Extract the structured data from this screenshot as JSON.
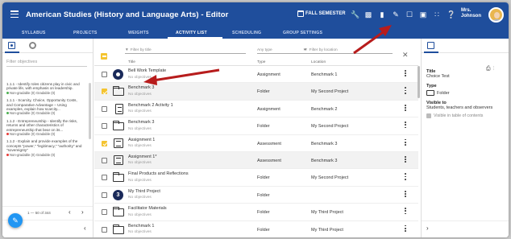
{
  "app": {
    "title": "American Studies (History and Language Arts) - Editor",
    "term": "FALL SEMESTER",
    "user": [
      "Mrs.",
      "Johnson"
    ]
  },
  "toolbar_icons": [
    "wrench-icon",
    "document-icon",
    "trash-icon",
    "pencil-icon",
    "clipboard-icon",
    "chat-icon",
    "apps-grid-icon",
    "help-icon"
  ],
  "nav": {
    "tabs": [
      "SYLLABUS",
      "PROJECTS",
      "WEIGHTS",
      "ACTIVITY LIST",
      "SCHEDULING",
      "GROUP SETTINGS"
    ],
    "active": "ACTIVITY LIST"
  },
  "left_panel": {
    "filter_placeholder": "Filter objectives",
    "objectives": [
      {
        "text": "1.1.1 - Identify roles citizens play in civic and private life, with emphasis on leadership.",
        "meta": "Non-gradable (0)  Gradable (0)",
        "dot": "#4caf50"
      },
      {
        "text": "1.1.1 - Scarcity, Choice, Opportunity Costs, and Comparative Advantage – Using examples, explain how scarcity...",
        "meta": "Non-gradable (0)  Gradable (0)",
        "dot": "#4caf50"
      },
      {
        "text": "1.1.2 - Entrepreneurship - Identify the risks, returns and other characteristics of entrepreneurship that bear on its...",
        "meta": "Non-gradable (0)  Gradable (0)",
        "dot": "#e53935"
      },
      {
        "text": "1.1.2 - Explain and provide examples of the concepts \"power,\" \"legitimacy,\" \"authority\" and \"sovereignty\"",
        "meta": "Non-gradable (0)  Gradable (0)",
        "dot": "#e53935"
      }
    ],
    "pagination": "1 — 50 of 344"
  },
  "main": {
    "filter_title_placeholder": "Filter by title",
    "filter_type": "Any type",
    "filter_location_placeholder": "Filter by location",
    "col_title": "Title",
    "col_type": "Type",
    "col_location": "Location",
    "rows": [
      {
        "icon": "disc",
        "name": "Bell Work Template",
        "objectives": "No objectives",
        "type": "Assignment",
        "location": "Benchmark 1",
        "checked": false,
        "selected": false
      },
      {
        "icon": "folder",
        "name": "Benchmark 3",
        "objectives": "No objectives",
        "type": "Folder",
        "location": "My Second Project",
        "checked": true,
        "selected": true
      },
      {
        "icon": "page",
        "name": "Benchmark 2 Activity 1",
        "objectives": "No objectives",
        "type": "Assignment",
        "location": "Benchmark 2",
        "checked": false,
        "selected": false
      },
      {
        "icon": "folder",
        "name": "Benchmark 3",
        "objectives": "No objectives",
        "type": "Folder",
        "location": "My Second Project",
        "checked": false,
        "selected": false
      },
      {
        "icon": "assess",
        "name": "Assignment 1",
        "objectives": "No objectives",
        "type": "Assessment",
        "location": "Benchmark 3",
        "checked": true,
        "selected": false
      },
      {
        "icon": "assess",
        "name": "Assignment 1*",
        "objectives": "No objectives",
        "type": "Assessment",
        "location": "Benchmark 3",
        "checked": false,
        "selected": true
      },
      {
        "icon": "folder",
        "name": "Final Products and Reflections",
        "objectives": "No objectives",
        "type": "Folder",
        "location": "My Second Project",
        "checked": false,
        "selected": false
      },
      {
        "icon": "proj",
        "name": "My Third Project",
        "objectives": "No objectives",
        "type": "Folder",
        "location": "",
        "checked": false,
        "selected": false
      },
      {
        "icon": "folder",
        "name": "Facilitator Materials",
        "objectives": "No objectives",
        "type": "Folder",
        "location": "My Third Project",
        "checked": false,
        "selected": false
      },
      {
        "icon": "folder",
        "name": "Benchmark 1",
        "objectives": "No objectives",
        "type": "Folder",
        "location": "My Third Project",
        "checked": false,
        "selected": false
      }
    ]
  },
  "right_panel": {
    "title_label": "Title",
    "title_value": "Choice Test",
    "type_label": "Type",
    "type_value": "Folder",
    "visible_label": "Visible to",
    "visible_value": "Students, teachers and observers",
    "table_check_label": "Visible in table of contents"
  },
  "colors": {
    "primary": "#1f4e9c",
    "accent": "#f4c430",
    "fab": "#2196f3",
    "annotation_arrow": "#b71c1c"
  }
}
